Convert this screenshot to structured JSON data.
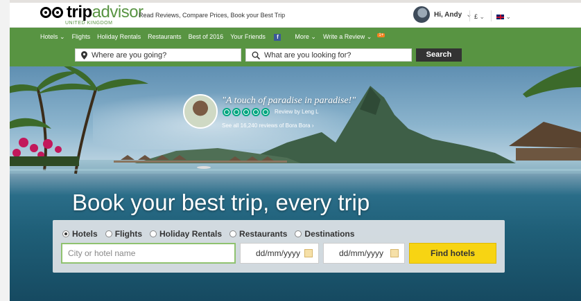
{
  "header": {
    "logo_trip": "trip",
    "logo_advisor": "advisor",
    "logo_sub": "UNITED KINGDOM",
    "tagline": "Read Reviews, Compare Prices, Book your Best Trip",
    "user_greeting": "Hi, Andy",
    "currency": "£",
    "chevron": "⌄"
  },
  "nav": {
    "items": [
      {
        "label": "Hotels ⌄"
      },
      {
        "label": "Flights"
      },
      {
        "label": "Holiday Rentals"
      },
      {
        "label": "Restaurants"
      },
      {
        "label": "Best of 2016"
      },
      {
        "label": "Your Friends"
      },
      {
        "label": "More ⌄"
      },
      {
        "label": "Write a Review ⌄"
      }
    ],
    "fb_glyph": "f",
    "badge": "1+"
  },
  "search": {
    "where_placeholder": "Where are you going?",
    "what_placeholder": "What are you looking for?",
    "button": "Search"
  },
  "hero": {
    "title": "Book your best trip, every trip",
    "quote": "\"A touch of paradise in paradise!\"",
    "review_by": "Review by Leng L",
    "see_all": "See all 16,240 reviews of Bora Bora  ›",
    "rating": 5
  },
  "booking": {
    "tabs": [
      {
        "label": "Hotels",
        "selected": true
      },
      {
        "label": "Flights",
        "selected": false
      },
      {
        "label": "Holiday Rentals",
        "selected": false
      },
      {
        "label": "Restaurants",
        "selected": false
      },
      {
        "label": "Destinations",
        "selected": false
      }
    ],
    "city_placeholder": "City or hotel name",
    "checkin_placeholder": "dd/mm/yyyy",
    "checkout_placeholder": "dd/mm/yyyy",
    "find_button": "Find hotels"
  },
  "colors": {
    "brand_green": "#589442",
    "search_button": "#333333",
    "find_button": "#f7d413",
    "bubble": "#00a680"
  }
}
